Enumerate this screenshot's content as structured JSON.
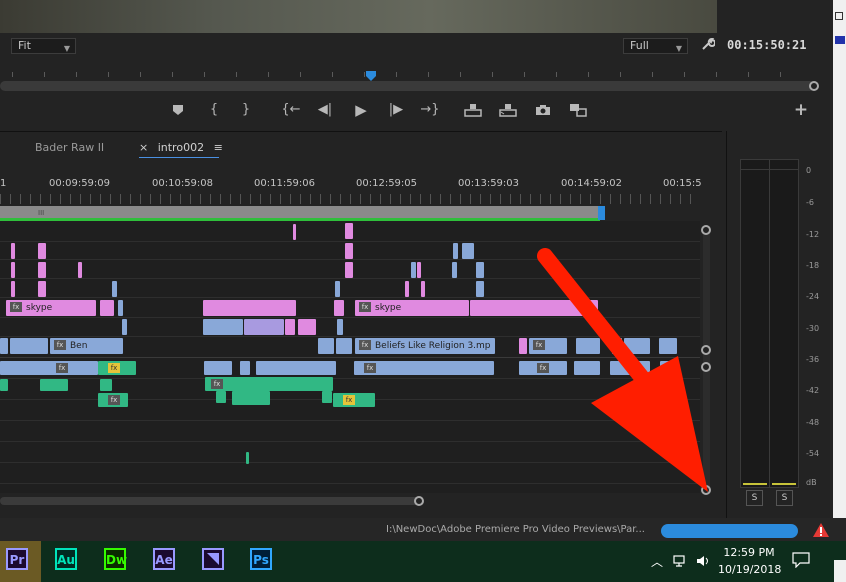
{
  "monitor": {
    "zoom_label": "Fit",
    "quality_label": "Full",
    "timecode": "00:15:50:21"
  },
  "icons": {
    "marker": "marker-icon",
    "mark_in": "mark-in-icon",
    "mark_out": "mark-out-icon",
    "go_to_in": "go-to-in-icon",
    "step_back": "step-back-icon",
    "play": "play-icon",
    "step_forward": "step-forward-icon",
    "go_to_out": "go-to-out-icon",
    "lift": "lift-icon",
    "extract": "extract-icon",
    "export_frame": "camera-icon",
    "comparison": "comparison-view-icon",
    "add": "plus-icon",
    "settings": "wrench-icon"
  },
  "timeline": {
    "tabs": [
      {
        "label": "Bader Raw II"
      },
      {
        "label": "intro002",
        "close": "×",
        "menu": "≡"
      }
    ],
    "ruler_prefix": "1",
    "timecodes": [
      "00:09:59:09",
      "00:10:59:08",
      "00:11:59:06",
      "00:12:59:05",
      "00:13:59:03",
      "00:14:59:02",
      "00:15:5"
    ],
    "clips": {
      "skype_1": "skype",
      "skype_2": "skype",
      "ben": "Ben",
      "beliefs": "Beliefs Like Religion 3.mp",
      "fx": "fx"
    }
  },
  "meter": {
    "db_labels": [
      "0",
      "-6",
      "-12",
      "-18",
      "-24",
      "-30",
      "-36",
      "-42",
      "-48",
      "-54",
      "dB"
    ],
    "solo_left": "S",
    "solo_right": "S"
  },
  "status": {
    "path_text": "I:\\NewDoc\\Adobe Premiere Pro Video Previews\\Par...",
    "progress": 1.0
  },
  "taskbar": {
    "apps": [
      {
        "label": "Pr",
        "color": "#9999ff"
      },
      {
        "label": "Au",
        "color": "#00e4bb"
      },
      {
        "label": "Dw",
        "color": "#35fa00"
      },
      {
        "label": "Ae",
        "color": "#9999ff"
      },
      {
        "label": "",
        "color": "#9999ff"
      },
      {
        "label": "Ps",
        "color": "#31a8ff"
      }
    ],
    "time": "12:59 PM",
    "date": "10/19/2018"
  },
  "colors": {
    "annotation_arrow": "#ff1e00",
    "playhead": "#2b8bdd",
    "warning": "#e53935"
  }
}
